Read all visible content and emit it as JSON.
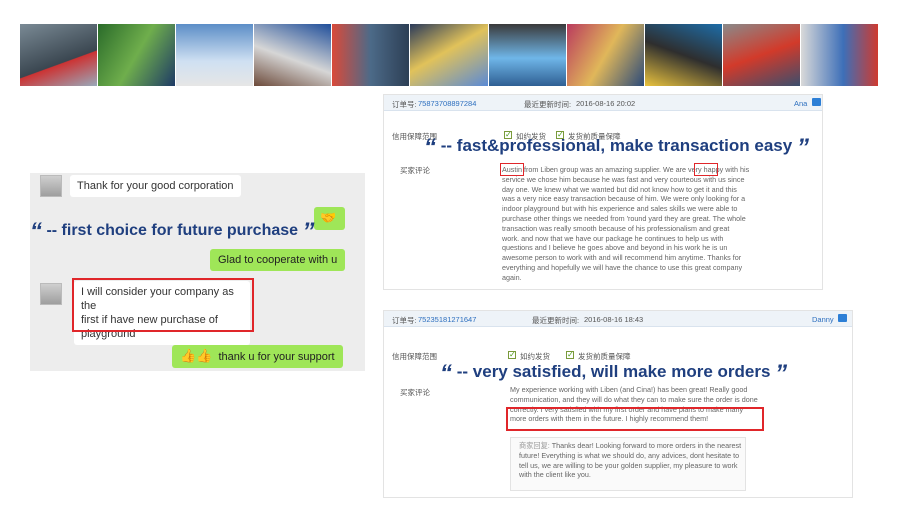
{
  "banner": {
    "photos": [
      "photo-1",
      "photo-2",
      "photo-3",
      "photo-4",
      "photo-5",
      "photo-6",
      "photo-7",
      "photo-8",
      "photo-9",
      "photo-10",
      "photo-11"
    ]
  },
  "chat": {
    "msg1": "Thank for your good corporation",
    "msg2": "Glad to cooperate with u",
    "msg3_l1": "I will consider your company as the",
    "msg3_l2": "first if have new purchase of",
    "msg3_l3": "playground",
    "msg4": "thank u for your support",
    "headline": "-- first choice for future purchase",
    "emoji_handshake": "🤝",
    "emoji_thumbs": "👍👍"
  },
  "review1": {
    "order_label": "订单号:",
    "order_no": "75873708897284",
    "updated_label": "最近更新时间:",
    "updated_time": "2016-08-16 20:02",
    "agent": "Ana",
    "guarantee_label": "信用保障范围",
    "guarantee_1": "如约发货",
    "guarantee_2": "发货前质量保障",
    "comment_label": "买家评论",
    "headline": "-- fast&professional, make transaction easy",
    "lines": [
      "Austin from Liben group was an amazing supplier. We are very happy with his",
      "service we chose him because he was fast and very courteous with us since",
      "day one. We knew what we wanted but did not know how to get it and this",
      "was a very nice easy transaction because of him. We were only looking for a",
      "indoor playground but with his experience and sales skills we were able to",
      "purchase other things we needed from 'round yard they are great. The whole",
      "transaction was really smooth because of his professionalism and great",
      "work. and now that we have our package he continues to help us with",
      "questions and I believe he goes above and beyond in his work he is un",
      "awesome person to work with and will recommend him anytime. Thanks for",
      "everything and hopefully we will have the chance to use this great company",
      "again."
    ]
  },
  "review2": {
    "order_label": "订单号:",
    "order_no": "75235181271647",
    "updated_label": "最近更新时间:",
    "updated_time": "2016-08-16 18:43",
    "agent": "Danny",
    "guarantee_label": "信用保障范围",
    "guarantee_1": "如约发货",
    "guarantee_2": "发货前质量保障",
    "comment_label": "买家评论",
    "headline": "-- very satisfied, will make more orders",
    "lines": [
      "My experience working with Liben (and Cina!) has been great! Really good",
      "communication, and they will do what they can to make sure the order is done",
      "correctly. I very satisfied with my first order and have plans to make many",
      "more orders with them in the future. I highly recommend them!"
    ],
    "reply_label": "商家回复:",
    "reply_lines": [
      "Thanks dear! Looking forward to more orders in the nearest",
      "future! Everything is what we should do, any advices, dont hesitate to",
      "tell us, we are willing to be your golden supplier, my pleasure to work",
      "with the client like you."
    ]
  },
  "quote_open": "“",
  "quote_close": "”",
  "colors": {
    "headline": "#1f3f7f",
    "highlight": "#e0262a",
    "chat_green": "#9fe658",
    "chat_bg": "#ededed"
  }
}
